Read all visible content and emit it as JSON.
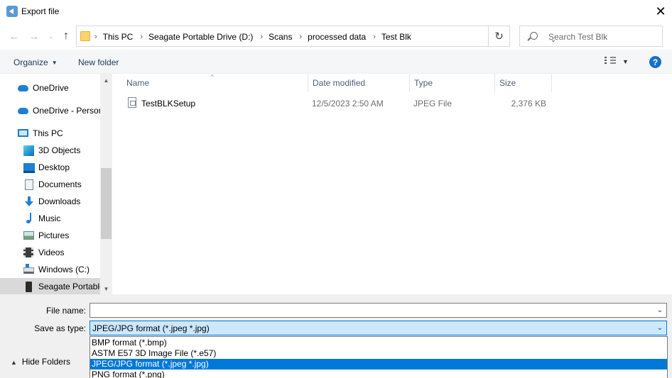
{
  "window": {
    "title": "Export file",
    "close_glyph": "✕"
  },
  "nav": {
    "back_glyph": "←",
    "forward_glyph": "→",
    "recent_glyph": "⌄",
    "up_glyph": "↑",
    "breadcrumbs": [
      "This PC",
      "Seagate Portable Drive (D:)",
      "Scans",
      "processed data",
      "Test Blk"
    ],
    "refresh_glyph": "↻",
    "dropdown_glyph": "⌄",
    "search_placeholder": "Search Test Blk"
  },
  "commandbar": {
    "organize_label": "Organize",
    "organize_caret": "▼",
    "new_folder_label": "New folder",
    "view_caret": "▼",
    "help_label": "?"
  },
  "navpane": {
    "items": [
      {
        "label": "OneDrive",
        "icon": "cloud-icon"
      },
      {
        "label": "OneDrive - Personal",
        "icon": "cloud-icon"
      },
      {
        "label": "This PC",
        "icon": "computer-icon"
      },
      {
        "label": "3D Objects",
        "icon": "cube-icon"
      },
      {
        "label": "Desktop",
        "icon": "desktop-icon"
      },
      {
        "label": "Documents",
        "icon": "document-icon"
      },
      {
        "label": "Downloads",
        "icon": "download-icon"
      },
      {
        "label": "Music",
        "icon": "music-icon"
      },
      {
        "label": "Pictures",
        "icon": "picture-icon"
      },
      {
        "label": "Videos",
        "icon": "video-icon"
      },
      {
        "label": "Windows (C:)",
        "icon": "drive-icon"
      },
      {
        "label": "Seagate Portable Drive (D:)",
        "icon": "portable-drive-icon",
        "selected": true
      }
    ],
    "scroll_up_glyph": "▲",
    "scroll_down_glyph": "▼"
  },
  "filelist": {
    "columns": [
      "Name",
      "Date modified",
      "Type",
      "Size"
    ],
    "sort_glyph": "^",
    "rows": [
      {
        "name": "TestBLKSetup",
        "date": "12/5/2023 2:50 AM",
        "type": "JPEG File",
        "size": "2,376 KB"
      }
    ]
  },
  "form": {
    "filename_label": "File name:",
    "filename_value": "",
    "savetype_label": "Save as type:",
    "savetype_value": "JPEG/JPG format (*.jpeg *.jpg)",
    "chevron_glyph": "⌄",
    "hide_folders_label": "Hide Folders",
    "hide_folders_glyph": "▲"
  },
  "dropdown": {
    "options": [
      "BMP format (*.bmp)",
      "ASTM E57 3D Image File (*.e57)",
      "JPEG/JPG format (*.jpeg *.jpg)",
      "PNG format (*.png)"
    ],
    "selected_index": 2
  },
  "colors": {
    "accent": "#0078d7",
    "selection_bg": "#cce8ff",
    "header_text": "#4c607a"
  }
}
